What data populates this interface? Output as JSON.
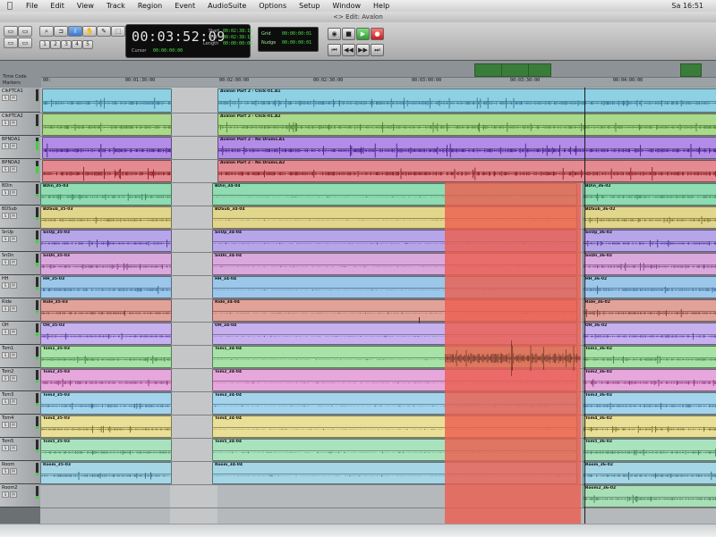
{
  "menubar": {
    "apple_glyph": "",
    "items": [
      "File",
      "Edit",
      "View",
      "Track",
      "Region",
      "Event",
      "AudioSuite",
      "Options",
      "Setup",
      "Window",
      "Help"
    ],
    "clock": "Sa 16:51"
  },
  "window": {
    "title": "<> Edit: Avalon"
  },
  "counter": {
    "main": "00:03:52:09",
    "start_label": "Start",
    "start": "00:02:38:15",
    "end_label": "End",
    "end": "00:02:38:15",
    "length_label": "Length",
    "length": "00:00:00:00",
    "cursor_label": "Cursor",
    "cursor": "00:00:00:00"
  },
  "grid": {
    "grid_label": "Grid",
    "grid_value": "00:00:00:01",
    "nudge_label": "Nudge",
    "nudge_value": "00:00:00:01"
  },
  "ruler": {
    "timecode_label": "Time Code",
    "markers_label": "Markers",
    "ticks": [
      "00:",
      "00:01:30:00",
      "00:02:00:00",
      "00:02:30:00",
      "00:03:00:00",
      "00:03:30:00",
      "00:04:00:00"
    ]
  },
  "tracks": [
    {
      "name": "ClkPTCA1",
      "lvl": 0.1
    },
    {
      "name": "ClkPTCA2",
      "lvl": 0.1
    },
    {
      "name": "BPNDA1",
      "lvl": 0.7
    },
    {
      "name": "BPNDA2",
      "lvl": 0.6
    },
    {
      "name": "BDin",
      "lvl": 0.2
    },
    {
      "name": "BDSub",
      "lvl": 0.2
    },
    {
      "name": "SnUp",
      "lvl": 0.3
    },
    {
      "name": "SnDn",
      "lvl": 0.3
    },
    {
      "name": "HH",
      "lvl": 0.2
    },
    {
      "name": "Ride",
      "lvl": 0.2
    },
    {
      "name": "OH",
      "lvl": 0.3
    },
    {
      "name": "Tom1",
      "lvl": 0.2
    },
    {
      "name": "Tom2",
      "lvl": 0.2
    },
    {
      "name": "Tom3",
      "lvl": 0.2
    },
    {
      "name": "Tom4",
      "lvl": 0.2
    },
    {
      "name": "Tom5",
      "lvl": 0.2
    },
    {
      "name": "Room",
      "lvl": 0.2
    },
    {
      "name": "Room2",
      "lvl": 0.2
    }
  ],
  "regions": [
    {
      "left": "",
      "mid": "Avalon Part 2 - Click-01.A1",
      "right": "",
      "color": "#8ed1e4",
      "wave": "#2a6f8f"
    },
    {
      "left": "",
      "mid": "Avalon Part 2 - Click-01.A2",
      "right": "",
      "color": "#a9d98a",
      "wave": "#3f7a2a"
    },
    {
      "left": "",
      "mid": "Avalon Part 2 - No Drums.A1",
      "right": "",
      "color": "#b28ce6",
      "wave": "#3b1486"
    },
    {
      "left": "",
      "mid": "Avalon Part 2 - No Drums.A2",
      "right": "",
      "color": "#e48a90",
      "wave": "#8a0d16"
    },
    {
      "left": "BDin_35-03",
      "mid": "BDin_34-04",
      "right": "BDin_36-02",
      "color": "#8fdcb2",
      "wave": "#2b7a4e"
    },
    {
      "left": "BDSub_35-03",
      "mid": "BDSub_34-04",
      "right": "BDSub_36-02",
      "color": "#e2d68c",
      "wave": "#6f6418"
    },
    {
      "left": "SnUp_35-03",
      "mid": "SnUp_34-04",
      "right": "SnUp_36-02",
      "color": "#b7a5ea",
      "wave": "#3d2694"
    },
    {
      "left": "SnDn_35-03",
      "mid": "SnDn_34-04",
      "right": "SnDn_36-02",
      "color": "#dba8de",
      "wave": "#752e7c"
    },
    {
      "left": "HH_35-03",
      "mid": "HH_34-04",
      "right": "HH_36-02",
      "color": "#9cc7ea",
      "wave": "#1f5a8f"
    },
    {
      "left": "Ride_35-03",
      "mid": "Ride_34-04",
      "right": "Ride_36-02",
      "color": "#e1a29a",
      "wave": "#7d2a1e"
    },
    {
      "left": "OH_35-03",
      "mid": "OH_34-04",
      "right": "OH_36-02",
      "color": "#c6b0ee",
      "wave": "#5a2fb4"
    },
    {
      "left": "Tom1_35-03",
      "mid": "Tom1_34-04",
      "right": "Tom1_36-02",
      "color": "#a7e2a7",
      "wave": "#2f7a2f"
    },
    {
      "left": "Tom2_35-03",
      "mid": "Tom2_34-04",
      "right": "Tom2_36-02",
      "color": "#e6a7dc",
      "wave": "#86216e"
    },
    {
      "left": "Tom3_35-03",
      "mid": "Tom3_34-04",
      "right": "Tom3_36-02",
      "color": "#a3d4ec",
      "wave": "#1d5f9a"
    },
    {
      "left": "Tom4_35-03",
      "mid": "Tom4_34-04",
      "right": "Tom4_36-02",
      "color": "#e9df97",
      "wave": "#6c5f12"
    },
    {
      "left": "Tom5_35-03",
      "mid": "Tom5_34-04",
      "right": "Tom5_36-02",
      "color": "#a9e3bd",
      "wave": "#2c7647"
    },
    {
      "left": "Room_35-03",
      "mid": "Room_34-04",
      "right": "Room_36-02",
      "color": "#a4d6e6",
      "wave": "#205d78"
    },
    {
      "left": "",
      "mid": "",
      "right": "Room2_36-02",
      "color": "#a9dfb7",
      "wave": "#2d7246"
    }
  ],
  "colors": {
    "selection": "#ec5f50",
    "counter_bg": "#0d0d0d",
    "counter_green": "#4ee24e"
  },
  "icons": [
    "apple-icon",
    "zoom-icon",
    "trim-icon",
    "selector-icon",
    "grabber-icon",
    "pencil-icon",
    "smart-tool-icon",
    "online-icon",
    "return-to-zero-icon",
    "stop-icon",
    "play-icon",
    "record-icon",
    "rewind-icon",
    "fast-forward-icon",
    "text-cursor-icon"
  ]
}
